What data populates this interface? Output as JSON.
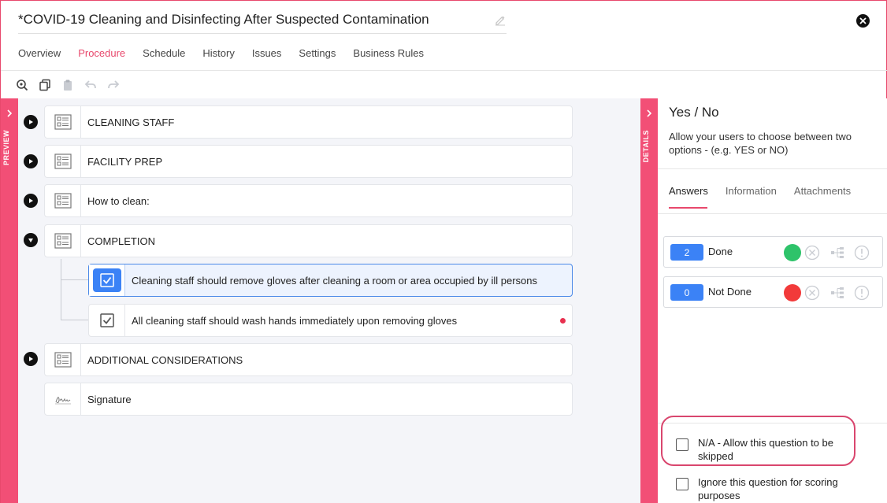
{
  "header": {
    "title": "*COVID-19 Cleaning and Disinfecting After Suspected Contamination"
  },
  "tabs": [
    {
      "label": "Overview"
    },
    {
      "label": "Procedure"
    },
    {
      "label": "Schedule"
    },
    {
      "label": "History"
    },
    {
      "label": "Issues"
    },
    {
      "label": "Settings"
    },
    {
      "label": "Business Rules"
    }
  ],
  "active_tab": "Procedure",
  "toolbar": {
    "icons": [
      "zoom-icon",
      "copy-icon",
      "paste-icon",
      "undo-icon",
      "redo-icon"
    ]
  },
  "preview_label": "PREVIEW",
  "details_label": "DETAILS",
  "procedure": {
    "sections": [
      {
        "label": "CLEANING STAFF",
        "state": "collapsed"
      },
      {
        "label": "FACILITY PREP",
        "state": "collapsed"
      },
      {
        "label": "How to clean:",
        "state": "collapsed"
      },
      {
        "label": "COMPLETION",
        "state": "expanded"
      },
      {
        "label": "ADDITIONAL CONSIDERATIONS",
        "state": "collapsed"
      }
    ],
    "steps": [
      {
        "label": "Cleaning staff should remove gloves after cleaning a room or area occupied by ill persons",
        "selected": true
      },
      {
        "label": "All cleaning staff should wash hands immediately upon removing gloves",
        "selected": false
      }
    ],
    "signature": {
      "label": "Signature"
    }
  },
  "details": {
    "title": "Yes / No",
    "description": "Allow your users to choose between two options - (e.g. YES or NO)",
    "tabs": [
      {
        "label": "Answers"
      },
      {
        "label": "Information"
      },
      {
        "label": "Attachments"
      }
    ],
    "answers": [
      {
        "score": "2",
        "label": "Done",
        "color": "#2ec36a"
      },
      {
        "score": "0",
        "label": "Not Done",
        "color": "#f23a3a"
      }
    ],
    "options": {
      "na": "N/A - Allow this question to be skipped",
      "ignore": "Ignore this question for scoring purposes"
    }
  },
  "colors": {
    "accent": "#e8486c",
    "strip": "#f24f76",
    "primary": "#3b82f6"
  }
}
